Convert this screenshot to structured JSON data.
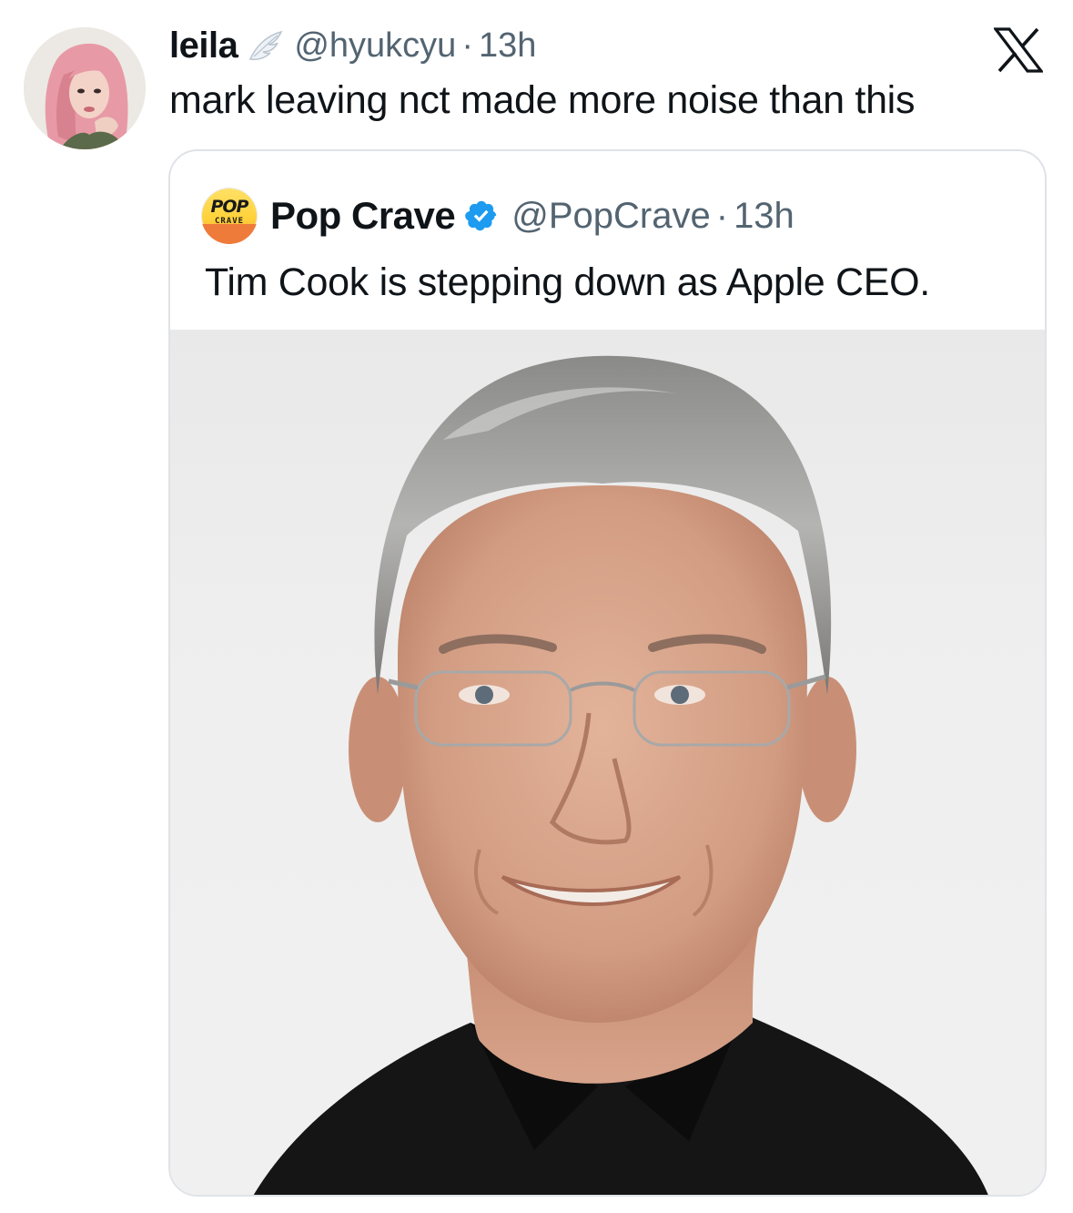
{
  "tweet": {
    "author_name": "leila",
    "author_handle": "@hyukcyu",
    "separator": "·",
    "time": "13h",
    "text": "mark leaving nct made more noise than this",
    "name_badge_icon": "angel-wing-icon"
  },
  "platform_logo": "x-logo-icon",
  "quoted_tweet": {
    "author_name": "Pop Crave",
    "author_handle": "@PopCrave",
    "separator": "·",
    "time": "13h",
    "text": "Tim Cook is stepping down as Apple CEO.",
    "verified_icon": "verified-badge-icon",
    "avatar_logo_text_top": "POP",
    "avatar_logo_text_bottom": "CRAVE",
    "colors": {
      "verified": "#1d9bf0",
      "logo_bottom": "#f5a03a"
    }
  },
  "colors": {
    "text": "#0f1419",
    "secondary": "#536471",
    "border": "#dfe3e7"
  }
}
